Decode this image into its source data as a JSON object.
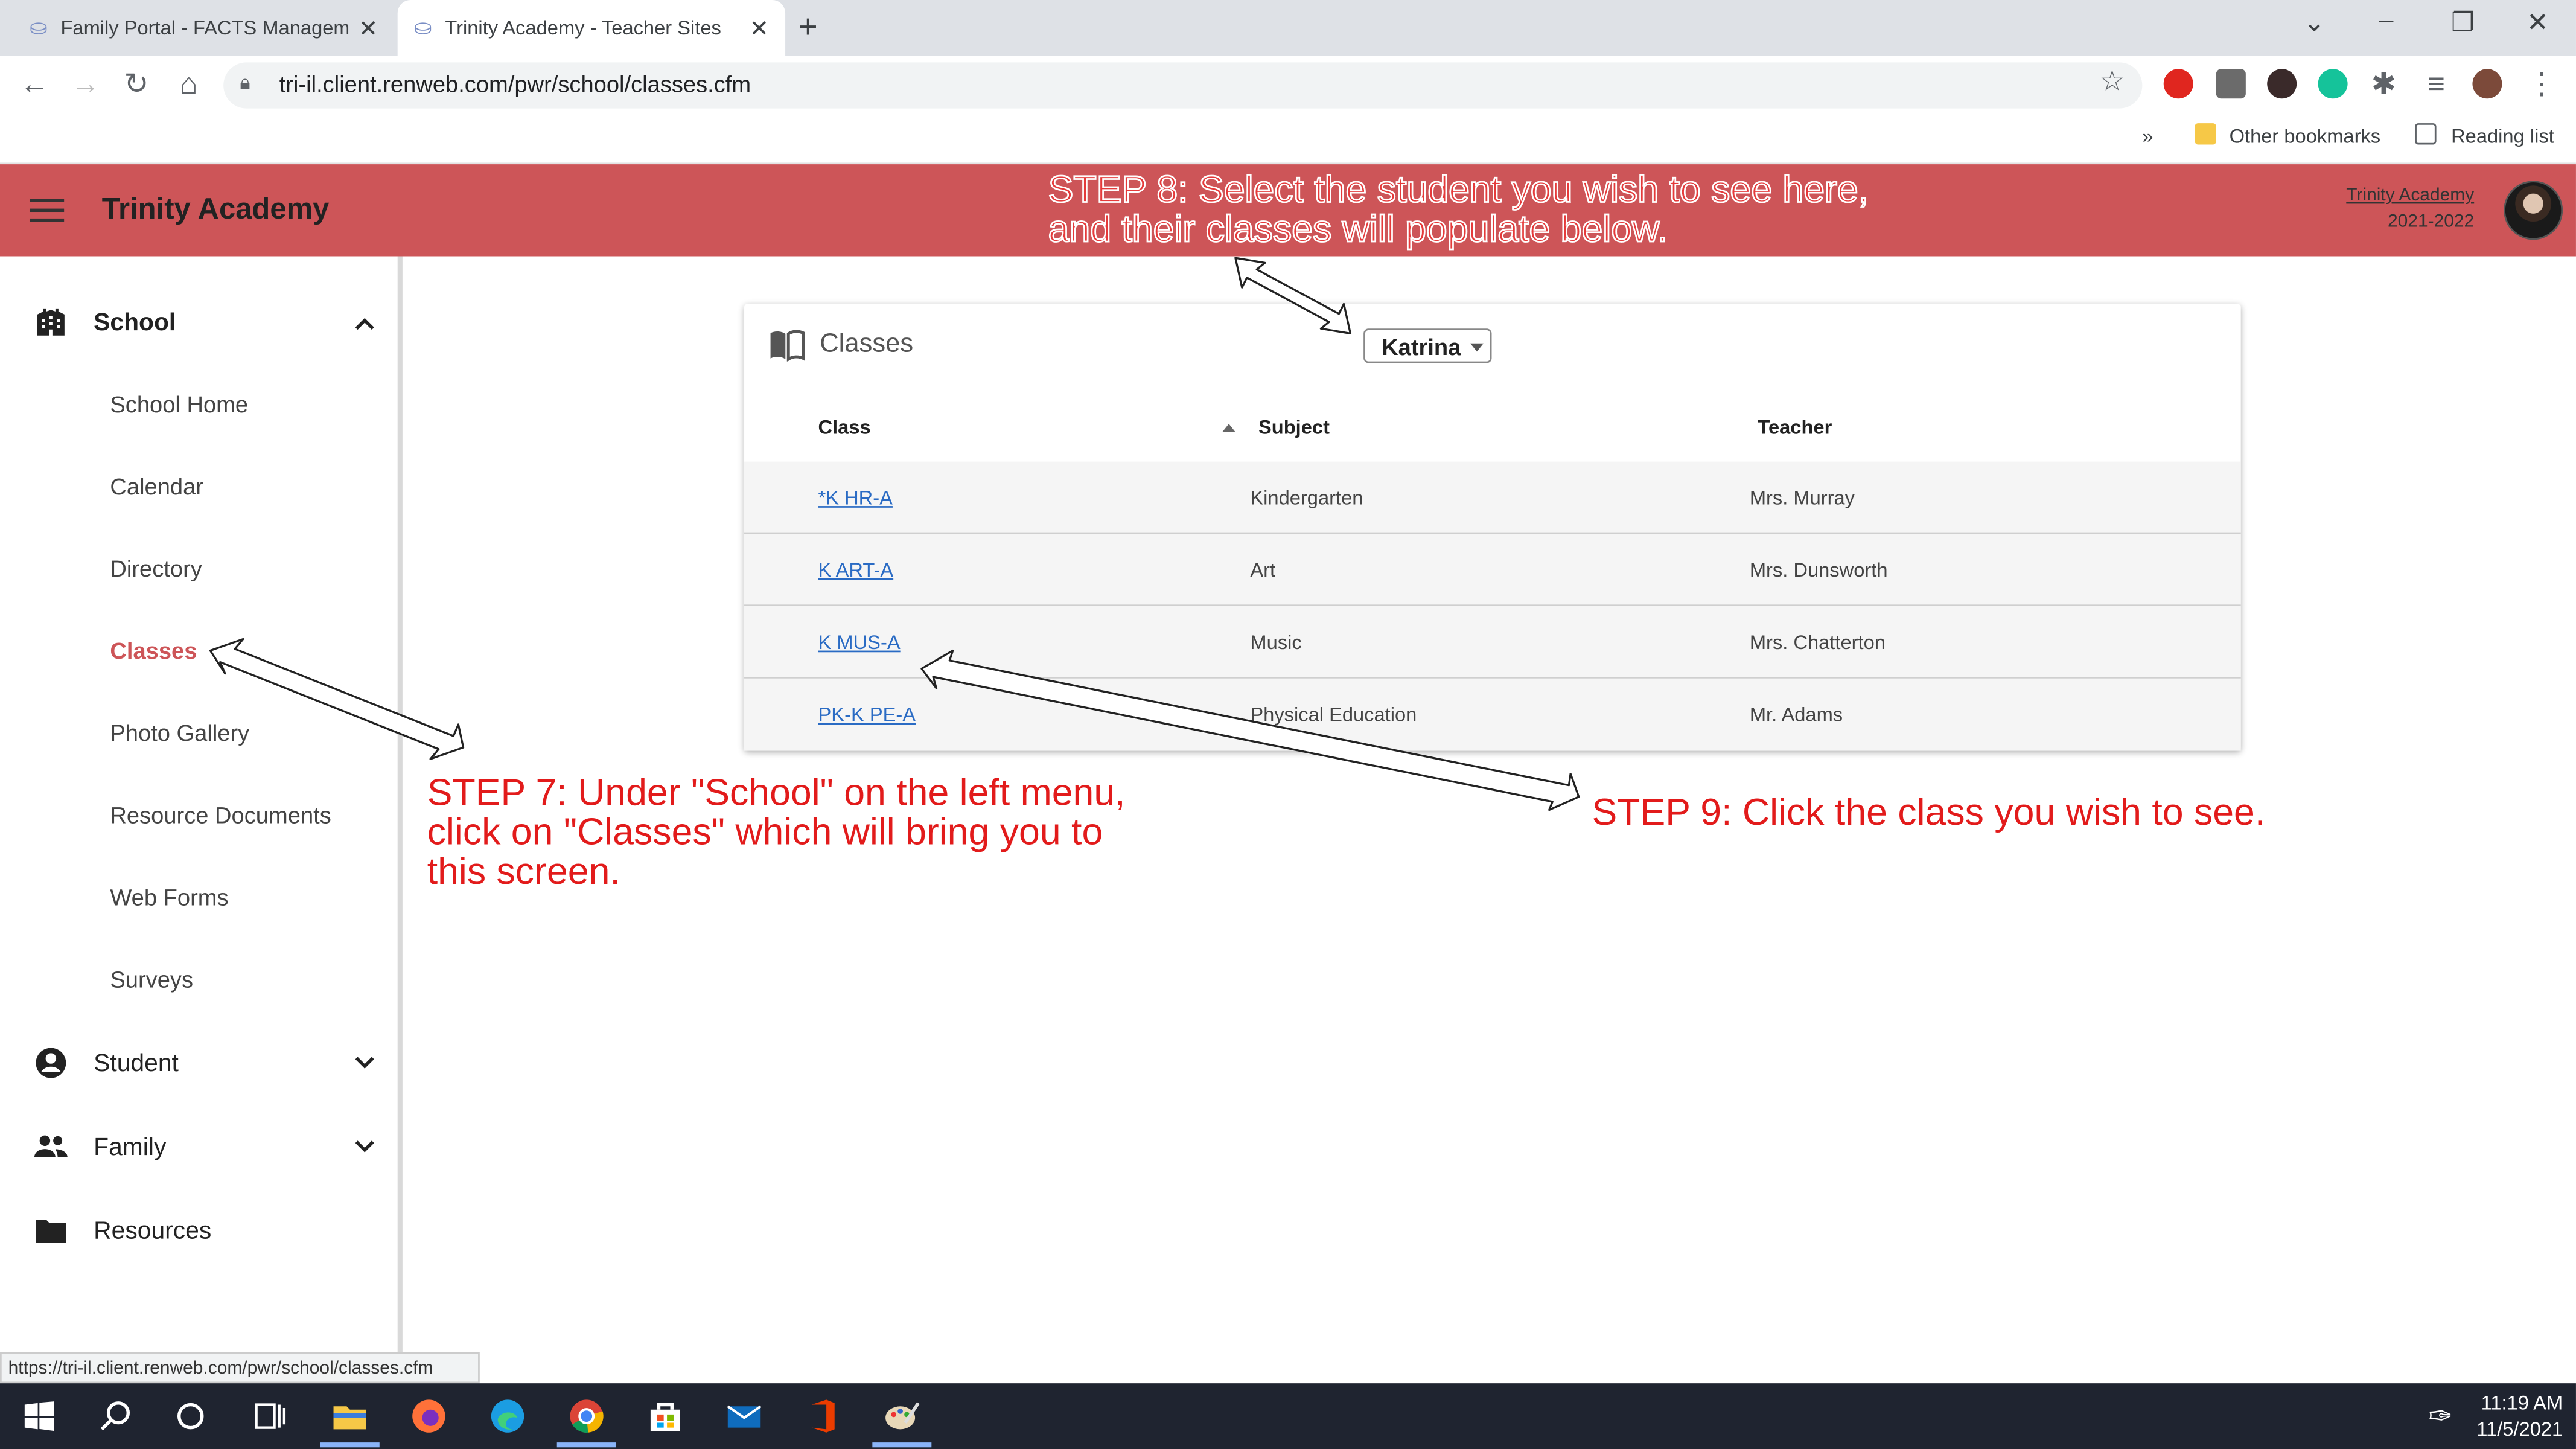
{
  "browser": {
    "tabs": [
      {
        "title": "Family Portal - FACTS Manageme",
        "active": false
      },
      {
        "title": "Trinity Academy - Teacher Sites",
        "active": true
      }
    ],
    "url": "tri-il.client.renweb.com/pwr/school/classes.cfm",
    "bookmarks": {
      "overflow": "»",
      "other": "Other bookmarks",
      "reading_list": "Reading list"
    },
    "status_url": "https://tri-il.client.renweb.com/pwr/school/classes.cfm"
  },
  "header": {
    "brand": "Trinity Academy",
    "school_name": "Trinity Academy",
    "school_year": "2021-2022",
    "color": "#cd5558"
  },
  "sidebar": {
    "sections": [
      {
        "label": "School",
        "icon": "building-icon",
        "expanded": true
      },
      {
        "label": "Student",
        "icon": "account-circle-icon",
        "expanded": false
      },
      {
        "label": "Family",
        "icon": "people-icon",
        "expanded": false
      },
      {
        "label": "Resources",
        "icon": "folder-icon",
        "expanded": false
      }
    ],
    "school_items": [
      {
        "label": "School Home"
      },
      {
        "label": "Calendar"
      },
      {
        "label": "Directory"
      },
      {
        "label": "Classes",
        "active": true
      },
      {
        "label": "Photo Gallery"
      },
      {
        "label": "Resource Documents"
      },
      {
        "label": "Web Forms"
      },
      {
        "label": "Surveys"
      }
    ]
  },
  "classes_card": {
    "title": "Classes",
    "student_selected": "Katrina",
    "columns": [
      "Class",
      "Subject",
      "Teacher"
    ],
    "rows": [
      {
        "class": "*K HR-A",
        "subject": "Kindergarten",
        "teacher": "Mrs. Murray"
      },
      {
        "class": "K ART-A",
        "subject": "Art",
        "teacher": "Mrs. Dunsworth"
      },
      {
        "class": "K MUS-A",
        "subject": "Music",
        "teacher": "Mrs. Chatterton"
      },
      {
        "class": "PK-K PE-A",
        "subject": "Physical Education",
        "teacher": "Mr. Adams"
      }
    ]
  },
  "annotations": {
    "step7": [
      "STEP 7: Under \"School\" on the left menu,",
      "click on \"Classes\" which will bring you to",
      "this screen."
    ],
    "step8": [
      "STEP 8: Select the student you wish to see here,",
      "and their classes will populate below."
    ],
    "step9": "STEP 9: Click the class you wish to see.",
    "color": "#e21b1b"
  },
  "taskbar": {
    "time": "11:19 AM",
    "date": "11/5/2021"
  }
}
